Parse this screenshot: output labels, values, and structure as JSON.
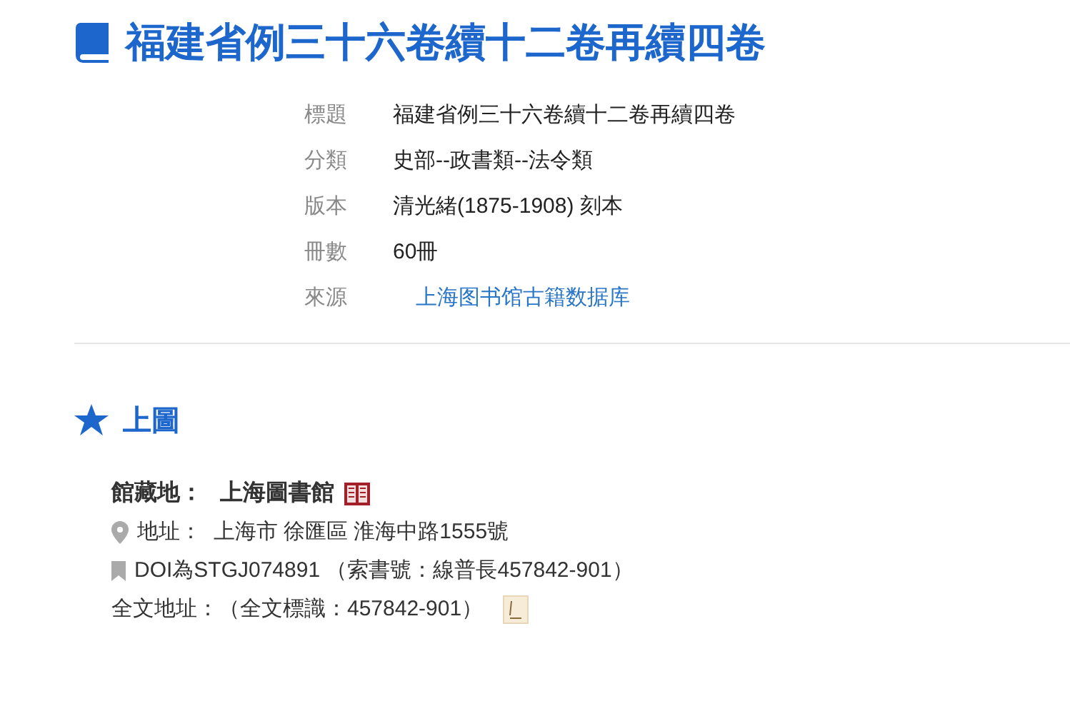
{
  "title": "福建省例三十六卷續十二卷再續四卷",
  "fields": [
    {
      "label": "標題",
      "value": "福建省例三十六卷續十二卷再續四卷",
      "kind": "text"
    },
    {
      "label": "分類",
      "value": "史部--政書類--法令類",
      "kind": "text"
    },
    {
      "label": "版本",
      "value": "清光緒(1875-1908) 刻本",
      "kind": "text"
    },
    {
      "label": "冊數",
      "value": "60冊",
      "kind": "text"
    },
    {
      "label": "來源",
      "value": "上海图书馆古籍数据库",
      "kind": "link"
    }
  ],
  "section": {
    "title": "上圖",
    "holding": {
      "label": "館藏地：",
      "library": "上海圖書館",
      "address": "地址：  上海市 徐匯區 淮海中路1555號",
      "doi": "DOI為STGJ074891 （索書號：線普長457842-901）",
      "fulltext": "全文地址：（全文標識：457842-901）"
    }
  }
}
